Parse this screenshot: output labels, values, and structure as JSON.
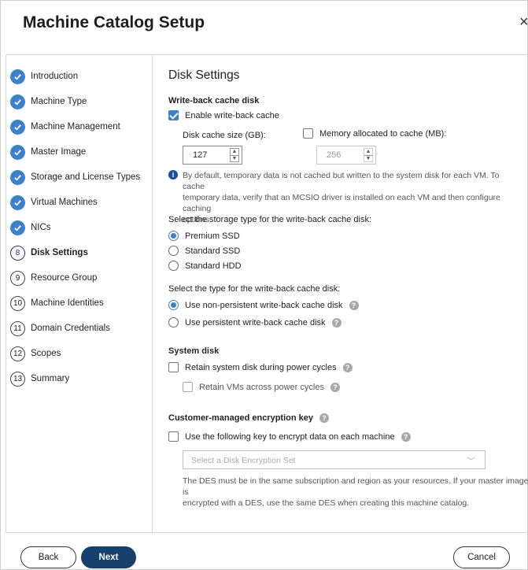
{
  "dialog": {
    "title": "Machine Catalog Setup",
    "close_glyph": "×"
  },
  "nav": {
    "items": [
      {
        "label": "Introduction",
        "state": "done"
      },
      {
        "label": "Machine Type",
        "state": "done"
      },
      {
        "label": "Machine Management",
        "state": "done"
      },
      {
        "label": "Master Image",
        "state": "done"
      },
      {
        "label": "Storage and License Types",
        "state": "done"
      },
      {
        "label": "Virtual Machines",
        "state": "done"
      },
      {
        "label": "NICs",
        "state": "done"
      },
      {
        "label": "Disk Settings",
        "number": "8",
        "state": "current"
      },
      {
        "label": "Resource Group",
        "number": "9",
        "state": "pending"
      },
      {
        "label": "Machine Identities",
        "number": "10",
        "state": "pending"
      },
      {
        "label": "Domain Credentials",
        "number": "11",
        "state": "pending"
      },
      {
        "label": "Scopes",
        "number": "12",
        "state": "pending"
      },
      {
        "label": "Summary",
        "number": "13",
        "state": "pending"
      }
    ]
  },
  "content": {
    "heading": "Disk Settings",
    "write_back": {
      "title": "Write-back cache disk",
      "enable_label": "Enable write-back cache",
      "enable_checked": true,
      "disk_cache_label": "Disk cache size (GB):",
      "disk_cache_value": "127",
      "memory_label": "Memory allocated to cache (MB):",
      "memory_checked": false,
      "memory_value": "256",
      "info_text_1": "By default, temporary data is not cached but written to the system disk for each VM. To cache",
      "info_text_2": "temporary data, verify that an MCSIO driver is installed on each VM and then configure caching",
      "info_text_3": "options."
    },
    "storage_type": {
      "prompt": "Select the storage type for the write-back cache disk:",
      "options": [
        "Premium SSD",
        "Standard SSD",
        "Standard HDD"
      ],
      "selected": "Premium SSD"
    },
    "cache_type": {
      "prompt": "Select the type for the write-back cache disk:",
      "options": [
        "Use non-persistent write-back cache disk",
        "Use persistent write-back cache disk"
      ],
      "selected": "Use non-persistent write-back cache disk"
    },
    "system_disk": {
      "title": "System disk",
      "retain_disk_label": "Retain system disk during power cycles",
      "retain_vms_label": "Retain VMs across power cycles"
    },
    "encryption": {
      "title": "Customer-managed encryption key",
      "use_key_label": "Use the following key to encrypt data on each machine",
      "select_placeholder": "Select a Disk Encryption Set",
      "note_1": "The DES must be in the same subscription and region as your resources. If your master image is",
      "note_2": "encrypted with a DES, use the same DES when creating this machine catalog."
    },
    "help_glyph": "?",
    "info_glyph": "i",
    "chevron_glyph": "﹀"
  },
  "footer": {
    "back_label": "Back",
    "next_label": "Next",
    "cancel_label": "Cancel"
  },
  "colors": {
    "accent": "#3b7fcf",
    "primary_button": "#16406e"
  }
}
